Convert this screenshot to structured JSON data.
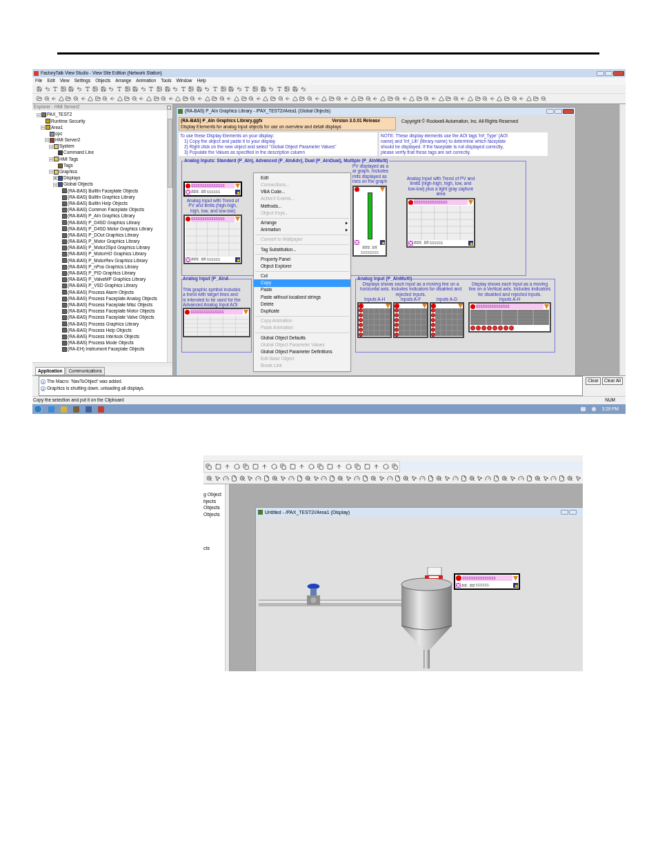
{
  "screenshot_1": {
    "title": "FactoryTalk View Studio - View Site Edition (Network Station)",
    "menu": [
      "File",
      "Edit",
      "View",
      "Settings",
      "Objects",
      "Arrange",
      "Animation",
      "Tools",
      "Window",
      "Help"
    ],
    "explorer": {
      "title": "Explorer - HMI Server2",
      "tree": [
        {
          "label": "PAX_TEST2",
          "kind": "application",
          "expanded": true,
          "children": [
            {
              "label": "Runtime Security",
              "kind": "security"
            },
            {
              "label": "Area1",
              "kind": "area",
              "expanded": true,
              "children": [
                {
                  "label": "opc",
                  "kind": "server"
                },
                {
                  "label": "HMI Server2",
                  "kind": "hmi-server",
                  "expanded": true,
                  "children": [
                    {
                      "label": "System",
                      "kind": "folder",
                      "expanded": true,
                      "children": [
                        {
                          "label": "Command Line",
                          "kind": "console"
                        }
                      ]
                    },
                    {
                      "label": "HMI Tags",
                      "kind": "folder",
                      "expanded": true,
                      "children": [
                        {
                          "label": "Tags",
                          "kind": "tags"
                        }
                      ]
                    },
                    {
                      "label": "Graphics",
                      "kind": "folder",
                      "expanded": true,
                      "children": [
                        {
                          "label": "Displays",
                          "kind": "graphics",
                          "expanded": false
                        },
                        {
                          "label": "Global Objects",
                          "kind": "graphics",
                          "expanded": true,
                          "children": [
                            {
                              "label": "(RA-BAS) Builtin Faceplate Objects",
                              "kind": "document"
                            },
                            {
                              "label": "(RA-BAS) Builtin Graphics Library",
                              "kind": "document"
                            },
                            {
                              "label": "(RA-BAS) Builtin Help Objects",
                              "kind": "document"
                            },
                            {
                              "label": "(RA-BAS) Common Faceplate Objects",
                              "kind": "document"
                            },
                            {
                              "label": "(RA-BAS) P_AIn Graphics Library",
                              "kind": "document"
                            },
                            {
                              "label": "(RA-BAS) P_D4SD Graphics Library",
                              "kind": "document"
                            },
                            {
                              "label": "(RA-BAS) P_D4SD Motor Graphics Library",
                              "kind": "document"
                            },
                            {
                              "label": "(RA-BAS) P_DOut Graphics Library",
                              "kind": "document"
                            },
                            {
                              "label": "(RA-BAS) P_Motor Graphics Library",
                              "kind": "document"
                            },
                            {
                              "label": "(RA-BAS) P_Motor2Spd Graphics Library",
                              "kind": "document"
                            },
                            {
                              "label": "(RA-BAS) P_MotorHO Graphics Library",
                              "kind": "document"
                            },
                            {
                              "label": "(RA-BAS) P_MotorRev Graphics Library",
                              "kind": "document"
                            },
                            {
                              "label": "(RA-BAS) P_nPos Graphics Library",
                              "kind": "document"
                            },
                            {
                              "label": "(RA-BAS) P_PID Graphics Library",
                              "kind": "document"
                            },
                            {
                              "label": "(RA-BAS) P_ValveMP Graphics Library",
                              "kind": "document"
                            },
                            {
                              "label": "(RA-BAS) P_VSD Graphics Library",
                              "kind": "document"
                            },
                            {
                              "label": "(RA-BAS) Process Alarm Objects",
                              "kind": "document"
                            },
                            {
                              "label": "(RA-BAS) Process Faceplate Analog Objects",
                              "kind": "document"
                            },
                            {
                              "label": "(RA-BAS) Process Faceplate Misc Objects",
                              "kind": "document"
                            },
                            {
                              "label": "(RA-BAS) Process Faceplate Motor Objects",
                              "kind": "document"
                            },
                            {
                              "label": "(RA-BAS) Process Faceplate Valve Objects",
                              "kind": "document"
                            },
                            {
                              "label": "(RA-BAS) Process Graphics Library",
                              "kind": "document"
                            },
                            {
                              "label": "(RA-BAS) Process Help Objects",
                              "kind": "document"
                            },
                            {
                              "label": "(RA-BAS) Process Interlock Objects",
                              "kind": "document"
                            },
                            {
                              "label": "(RA-BAS) Process Mode Objects",
                              "kind": "document"
                            },
                            {
                              "label": "(RA-EH) Instrument Faceplate Objects",
                              "kind": "document"
                            }
                          ]
                        }
                      ]
                    }
                  ]
                }
              ]
            }
          ]
        }
      ],
      "tabs": [
        {
          "label": "Application",
          "selected": true
        },
        {
          "label": "Communications",
          "selected": false
        }
      ]
    },
    "library_window": {
      "title": "(RA-BAS) P_AIn Graphics Library - /PAX_TEST2//Area1 (Global Objects)",
      "file": "(RA-BAS) P_AIn Graphics Library.ggfx",
      "version": "Version 3.0.01 Release",
      "description": "Display Elements for analog input objects for use on overview and detail displays",
      "copyright": "Copyright © Rockwell Automation, Inc.   All Rights Reserved",
      "instructions": [
        "To use these Display Elements on your display:",
        "1)  Copy the object and paste it to your display",
        "2)  Right click on the new object and select \"Global Object Parameter Values\"",
        "3)  Populate the Values as specified in the description column"
      ],
      "note": [
        "NOTE:  These display elements use the AOI tags 'Inf_Type' (AOI",
        "name) and 'Inf_Lib' (library name) to determine which faceplate",
        "should be displayed.  If the faceplate is not displayed correctly,",
        "please verify that these tags are set correctly."
      ],
      "group_1": {
        "title": "Analog Inputs: Standard (P_AIn), Advanced (P_AInAdv),  Dual (P_AInDual), Multiple (P_AInMulti)",
        "indicator": {
          "tag": "sssssssssssssss",
          "value": "###. ##",
          "units": "ssssss"
        },
        "trend_caption": "Analog Input with Trend of PV and limits (high-high, high, low, and low-low)",
        "trend": {
          "tag": "sssssssssssssss",
          "value": "###. ##",
          "units": "ssssss"
        },
        "bar_caption_lines": [
          "PV displayed as a",
          "ar graph.  Includes",
          "mits displayed as",
          "ines on the graph"
        ],
        "bar": {
          "value": "###. ##",
          "units": "ssssssss"
        },
        "capture_caption": "Analog Input with Trend of PV and limits (high-high, high, low, and low-low) plus a light gray capture area",
        "capture_trend": {
          "tag": "sssssssssssssss",
          "value": "###. ##",
          "units": "ssssss"
        }
      },
      "group_2": {
        "title": "Analog Input (P_AInA",
        "caption_lines": [
          "This graphic symbol includes",
          "a trend with target lines and",
          "is intended to be used for the",
          "Advanced Analog Input AOI"
        ],
        "tag": "sssssssssssssss"
      },
      "group_3": {
        "title": "Analog Input (P_AInMulti)",
        "horizontal_caption": "Displays shows each input as a moving line on a horizontal axis.  Includes indicators for disabled and rejected inputs.",
        "vertical_caption": "Display shows each input as a moving line on a Vertical axis.  Includes indicators for disabled and rejected inputs.",
        "horizontal_inputs": [
          "Inputs A-H",
          "Inputs A-F",
          "Inputs A-D"
        ],
        "vertical_inputs": "Inputs A-H",
        "vertical_tag": "sssssssssssssss"
      }
    },
    "context_menu": [
      {
        "kind": "item",
        "label": "Edit",
        "disabled": false,
        "selected": false,
        "submenu": false
      },
      {
        "kind": "item",
        "label": "Connections...",
        "disabled": true,
        "selected": false,
        "submenu": false
      },
      {
        "kind": "item",
        "label": "VBA Code...",
        "disabled": false,
        "selected": false,
        "submenu": false
      },
      {
        "kind": "item",
        "label": "ActiveX Events...",
        "disabled": true,
        "selected": false,
        "submenu": false
      },
      {
        "kind": "item",
        "label": "Methods...",
        "disabled": false,
        "selected": false,
        "submenu": false
      },
      {
        "kind": "item",
        "label": "Object Keys...",
        "disabled": true,
        "selected": false,
        "submenu": false
      },
      {
        "kind": "separator"
      },
      {
        "kind": "item",
        "label": "Arrange",
        "disabled": false,
        "selected": false,
        "submenu": true
      },
      {
        "kind": "item",
        "label": "Animation",
        "disabled": false,
        "selected": false,
        "submenu": true
      },
      {
        "kind": "separator"
      },
      {
        "kind": "item",
        "label": "Convert to Wallpaper",
        "disabled": true,
        "selected": false,
        "submenu": false
      },
      {
        "kind": "separator"
      },
      {
        "kind": "item",
        "label": "Tag Substitution...",
        "disabled": false,
        "selected": false,
        "submenu": false
      },
      {
        "kind": "separator"
      },
      {
        "kind": "item",
        "label": "Property Panel",
        "disabled": false,
        "selected": false,
        "submenu": false
      },
      {
        "kind": "item",
        "label": "Object Explorer",
        "disabled": false,
        "selected": false,
        "submenu": false
      },
      {
        "kind": "separator"
      },
      {
        "kind": "item",
        "label": "Cut",
        "disabled": false,
        "selected": false,
        "submenu": false
      },
      {
        "kind": "item",
        "label": "Copy",
        "disabled": false,
        "selected": true,
        "submenu": false
      },
      {
        "kind": "item",
        "label": "Paste",
        "disabled": false,
        "selected": false,
        "submenu": false
      },
      {
        "kind": "item",
        "label": "Paste without localized strings",
        "disabled": false,
        "selected": false,
        "submenu": false
      },
      {
        "kind": "item",
        "label": "Delete",
        "disabled": false,
        "selected": false,
        "submenu": false
      },
      {
        "kind": "item",
        "label": "Duplicate",
        "disabled": false,
        "selected": false,
        "submenu": false
      },
      {
        "kind": "separator"
      },
      {
        "kind": "item",
        "label": "Copy Animation",
        "disabled": true,
        "selected": false,
        "submenu": false
      },
      {
        "kind": "item",
        "label": "Paste Animation",
        "disabled": true,
        "selected": false,
        "submenu": false
      },
      {
        "kind": "separator"
      },
      {
        "kind": "item",
        "label": "Global Object Defaults",
        "disabled": false,
        "selected": false,
        "submenu": false
      },
      {
        "kind": "item",
        "label": "Global Object Parameter Values",
        "disabled": true,
        "selected": false,
        "submenu": false
      },
      {
        "kind": "item",
        "label": "Global Object Parameter Definitions",
        "disabled": false,
        "selected": false,
        "submenu": false
      },
      {
        "kind": "item",
        "label": "Edit Base Object",
        "disabled": true,
        "selected": false,
        "submenu": false
      },
      {
        "kind": "item",
        "label": "Break Link",
        "disabled": true,
        "selected": false,
        "submenu": false
      }
    ],
    "diagnostics": {
      "messages": [
        "The Macro: 'NavToObject' was added.",
        "Graphics is shutting down, unloading all displays."
      ],
      "buttons": [
        "Clear",
        "Clear All"
      ]
    },
    "status_bar": {
      "message": "Copy the selection and put it on the Clipboard",
      "indicator": "NUM"
    },
    "taskbar": {
      "clock": "3:29 PM"
    }
  },
  "screenshot_2": {
    "explorer_fragments": [
      "g Object",
      "bjects",
      "Objects",
      "Objects",
      "cts"
    ],
    "window": {
      "title": "Untitled - /PAX_TEST2//Area1 (Display)"
    },
    "faceplate": {
      "tag": "sssssssssssssss",
      "value": "##. ##",
      "units": "ssssss"
    }
  }
}
